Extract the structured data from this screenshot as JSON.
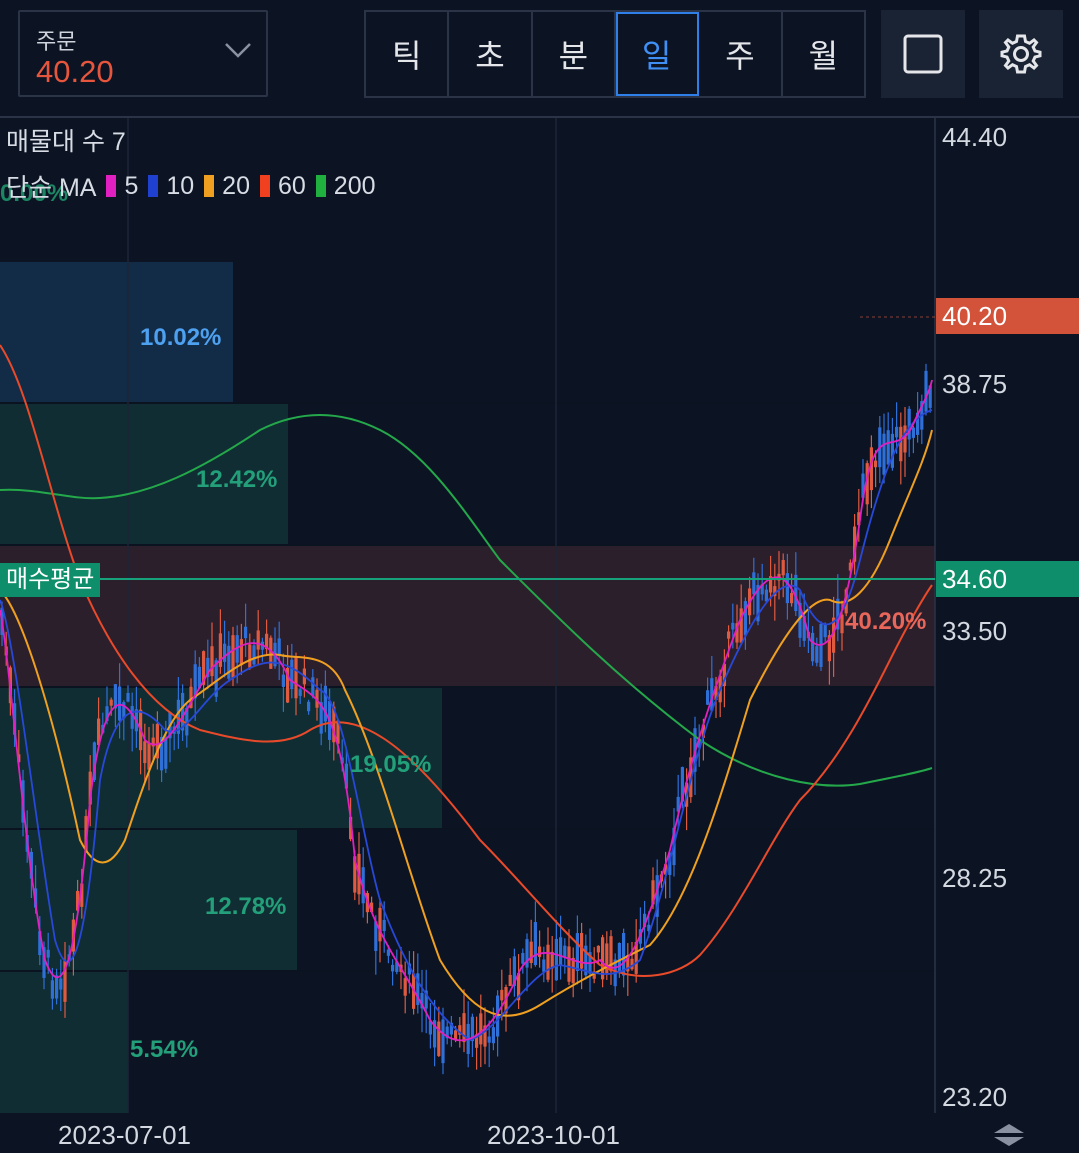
{
  "order": {
    "label": "주문",
    "value": "40.20"
  },
  "periods": [
    "틱",
    "초",
    "분",
    "일",
    "주",
    "월"
  ],
  "active_period": "일",
  "toolbar": {
    "layout_icon": "square-icon",
    "settings_icon": "gear-icon"
  },
  "legend": {
    "volume_profile": "매물대 수 7",
    "ma_title": "단순 MA",
    "ma_items": [
      {
        "label": "5",
        "color": "#e020c0"
      },
      {
        "label": "10",
        "color": "#2040d0"
      },
      {
        "label": "20",
        "color": "#f0a020"
      },
      {
        "label": "60",
        "color": "#f04020"
      },
      {
        "label": "200",
        "color": "#20b040"
      }
    ]
  },
  "volume_profile": {
    "top_label": "0.00%",
    "bins": [
      "10.02%",
      "12.42%",
      "40.20%",
      "19.05%",
      "12.78%",
      "5.54%"
    ]
  },
  "avg_line": {
    "label": "매수평균",
    "value": "34.60"
  },
  "current_price": "40.20",
  "y_ticks": [
    "44.40",
    "38.75",
    "33.50",
    "28.25",
    "23.20"
  ],
  "x_ticks": [
    "2023-07-01",
    "2023-10-01"
  ],
  "colors": {
    "up": "#e05a40",
    "down": "#2f6fd8",
    "avg": "#0e8e6b",
    "accent": "#3f8ff4"
  }
}
